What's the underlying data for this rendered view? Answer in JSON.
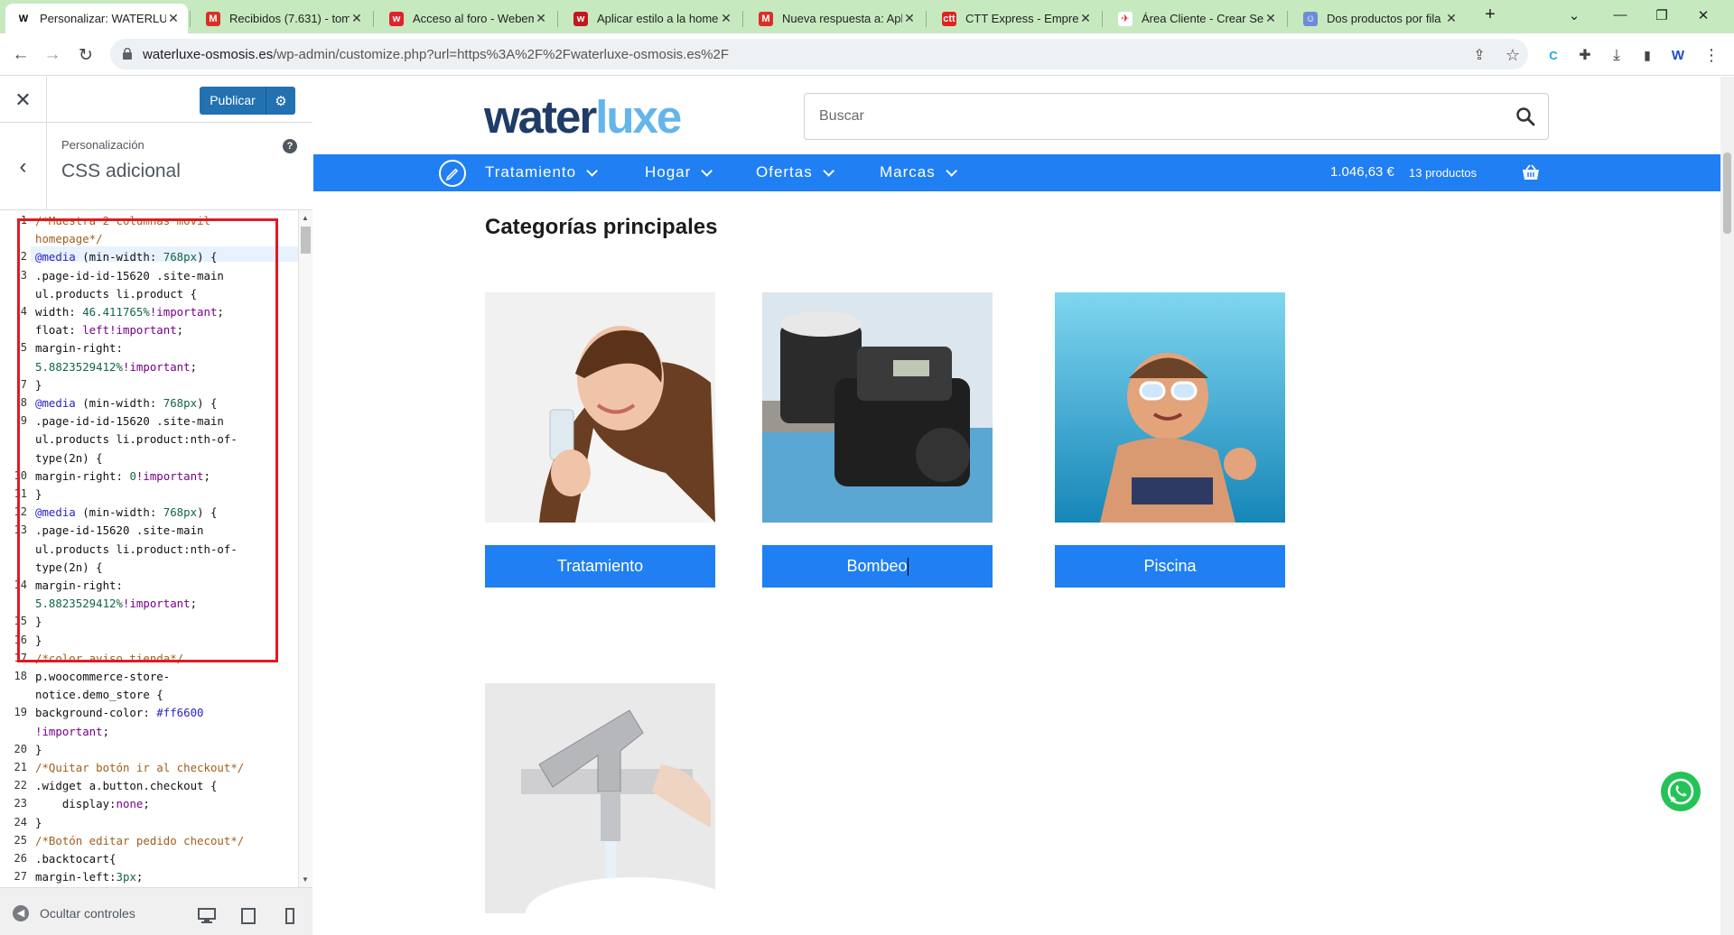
{
  "browser": {
    "tabs": [
      {
        "label": "Personalizar: WATERLUXE",
        "fav": "W",
        "fav_color": "#ffffff",
        "fav_text": "#000000"
      },
      {
        "label": "Recibidos (7.631) - tom",
        "fav": "M",
        "fav_color": "#d93025",
        "fav_text": "#ffffff"
      },
      {
        "label": "Acceso al foro - Webem",
        "fav": "w",
        "fav_color": "#e0232b",
        "fav_text": "#ffffff"
      },
      {
        "label": "Aplicar estilo a la home",
        "fav": "w",
        "fav_color": "#c4161c",
        "fav_text": "#ffffff"
      },
      {
        "label": "Nueva respuesta a: Apli",
        "fav": "M",
        "fav_color": "#d93025",
        "fav_text": "#ffffff"
      },
      {
        "label": "CTT Express - Empresa",
        "fav": "ctt",
        "fav_color": "#e0231c",
        "fav_text": "#ffffff"
      },
      {
        "label": "Área Cliente - Crear Se",
        "fav": "✈",
        "fav_color": "#ffffff",
        "fav_text": "#d9262c"
      },
      {
        "label": "Dos productos por fila",
        "fav": "☺",
        "fav_color": "#6b8cd6",
        "fav_text": "#ffffff"
      }
    ],
    "url_host": "waterluxe-osmosis.es",
    "url_path": "/wp-admin/customize.php?url=https%3A%2F%2Fwaterluxe-osmosis.es%2F"
  },
  "sidebar": {
    "publish_label": "Publicar",
    "section_sub": "Personalización",
    "section_title": "CSS adicional",
    "hide_controls": "Ocultar controles",
    "code_lines": [
      {
        "num": "1",
        "html": "<span class='c'>/*Muestra 2 columnas movil</span>"
      },
      {
        "num": "",
        "html": "<span class='c'>homepage*/</span>"
      },
      {
        "num": "2",
        "html": "<span class='k'>@media</span> (min-width: <span class='n'>768px</span>) {"
      },
      {
        "num": "3",
        "html": ".page-id-id-15620 .site-main"
      },
      {
        "num": "",
        "html": "ul.products li.product {"
      },
      {
        "num": "4",
        "html": "width: <span class='n'>46.411765%</span><span class='s'>!important</span>;"
      },
      {
        "num": "",
        "html": "float: <span class='s'>left</span><span class='s'>!important</span>;"
      },
      {
        "num": "5",
        "html": "margin-right:"
      },
      {
        "num": "",
        "html": "<span class='n'>5.8823529412%</span><span class='s'>!important</span>;"
      },
      {
        "num": "7",
        "html": "}"
      },
      {
        "num": "8",
        "html": "<span class='k'>@media</span> (min-width: <span class='n'>768px</span>) {"
      },
      {
        "num": "9",
        "html": ".page-id-id-15620 .site-main"
      },
      {
        "num": "",
        "html": "ul.products li.product:nth-of-"
      },
      {
        "num": "",
        "html": "type(2n) {"
      },
      {
        "num": "10",
        "html": "margin-right: <span class='n'>0</span><span class='s'>!important</span>;"
      },
      {
        "num": "11",
        "html": "}"
      },
      {
        "num": "12",
        "html": "<span class='k'>@media</span> (min-width: <span class='n'>768px</span>) {"
      },
      {
        "num": "13",
        "html": ".page-id-15620 .site-main"
      },
      {
        "num": "",
        "html": "ul.products li.product:nth-of-"
      },
      {
        "num": "",
        "html": "type(2n) {"
      },
      {
        "num": "14",
        "html": "margin-right:"
      },
      {
        "num": "",
        "html": "<span class='n'>5.8823529412%</span><span class='s'>!important</span>;"
      },
      {
        "num": "15",
        "html": "}"
      },
      {
        "num": "16",
        "html": "}"
      },
      {
        "num": "17",
        "html": "<span class='c'>/*color aviso tienda*/</span>"
      },
      {
        "num": "18",
        "html": "p.woocommerce-store-"
      },
      {
        "num": "",
        "html": "notice.demo_store {"
      },
      {
        "num": "19",
        "html": "background-color: <span class='h'>#ff6600</span>"
      },
      {
        "num": "",
        "html": "<span class='s'>!important</span>;"
      },
      {
        "num": "20",
        "html": "}"
      },
      {
        "num": "21",
        "html": "<span class='c'>/*Quitar botón ir al checkout*/</span>"
      },
      {
        "num": "22",
        "html": ".widget a.button.checkout {"
      },
      {
        "num": "23",
        "html": "    display:<span class='s'>none</span>;"
      },
      {
        "num": "24",
        "html": "}"
      },
      {
        "num": "25",
        "html": "<span class='c'>/*Botón editar pedido checout*/</span>"
      },
      {
        "num": "26",
        "html": ".backtocart{"
      },
      {
        "num": "27",
        "html": "margin-left:<span class='n'>3px</span>;"
      }
    ]
  },
  "site": {
    "logo_part1": "water",
    "logo_part2": "luxe",
    "search_placeholder": "Buscar",
    "nav": [
      "Tratamiento",
      "Hogar",
      "Ofertas",
      "Marcas"
    ],
    "cart_total": "1.046,63 €",
    "cart_count": "13 productos",
    "categories_title": "Categorías principales",
    "categories": [
      "Tratamiento",
      "Bombeo",
      "Piscina"
    ],
    "accent_color": "#1f7ff3"
  }
}
